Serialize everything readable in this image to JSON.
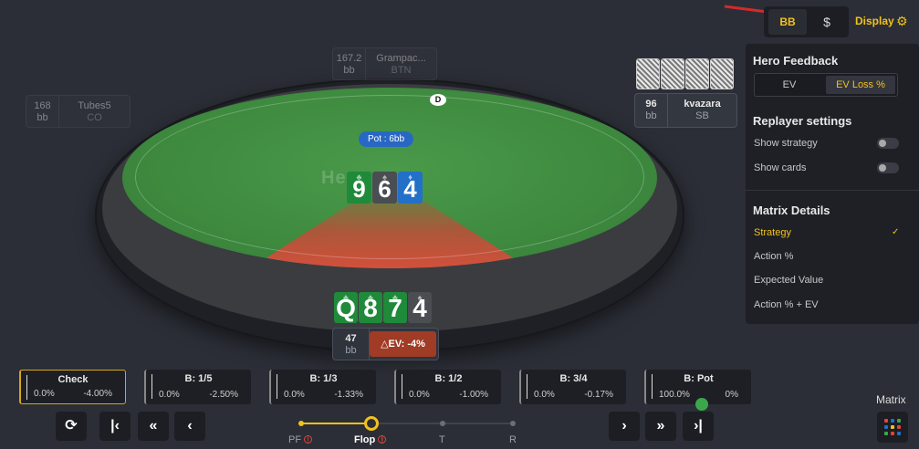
{
  "topbar": {
    "bb_label": "BB",
    "dollar_label": "$",
    "display_label": "Display"
  },
  "table": {
    "logo_text": "Hero",
    "pot_label": "Pot : 6bb",
    "dealer_button": "D",
    "board": [
      {
        "rank": "9",
        "color": "green",
        "suit": "♣"
      },
      {
        "rank": "6",
        "color": "grey",
        "suit": "♠"
      },
      {
        "rank": "4",
        "color": "blue",
        "suit": "♦"
      }
    ],
    "hero_cards": [
      {
        "rank": "Q",
        "color": "green",
        "suit": "♣"
      },
      {
        "rank": "8",
        "color": "green",
        "suit": "♣"
      },
      {
        "rank": "7",
        "color": "green",
        "suit": "♣"
      },
      {
        "rank": "4",
        "color": "grey",
        "suit": "♠"
      }
    ]
  },
  "seats": {
    "btn": {
      "stack": "167.2",
      "unit": "bb",
      "name": "Grampac...",
      "position": "BTN"
    },
    "co": {
      "stack": "168",
      "unit": "bb",
      "name": "Tubes5",
      "position": "CO"
    },
    "sb": {
      "stack": "96",
      "unit": "bb",
      "name": "kvazara",
      "position": "SB"
    },
    "hero": {
      "stack": "47",
      "unit": "bb",
      "ev": "△EV: -4%"
    }
  },
  "panel": {
    "hero_feedback_title": "Hero Feedback",
    "seg_ev": "EV",
    "seg_evloss": "EV Loss %",
    "replayer_title": "Replayer settings",
    "show_strategy": "Show strategy",
    "show_cards": "Show cards",
    "matrix_title": "Matrix Details",
    "opt_strategy": "Strategy",
    "opt_strategy_check": "✓",
    "opt_action": "Action %",
    "opt_expected": "Expected Value",
    "opt_action_ev": "Action % + EV"
  },
  "actions": [
    {
      "label": "Check",
      "left": "0.0%",
      "right": "-4.00%"
    },
    {
      "label": "B: 1/5",
      "left": "0.0%",
      "right": "-2.50%"
    },
    {
      "label": "B: 1/3",
      "left": "0.0%",
      "right": "-1.33%"
    },
    {
      "label": "B: 1/2",
      "left": "0.0%",
      "right": "-1.00%"
    },
    {
      "label": "B: 3/4",
      "left": "0.0%",
      "right": "-0.17%"
    },
    {
      "label": "B: Pot",
      "left": "100.0%",
      "right": "0%"
    }
  ],
  "streets": {
    "pf": "PF",
    "flop": "Flop",
    "turn": "T",
    "river": "R",
    "warn": "!"
  },
  "matrix_label": "Matrix",
  "colors": {
    "accent": "#f2c21b",
    "ev_loss": "#a03b25",
    "pot": "#2868c4"
  }
}
